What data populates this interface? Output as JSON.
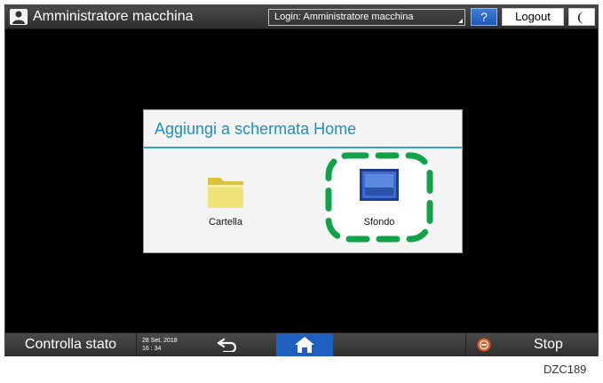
{
  "topbar": {
    "title": "Amministratore macchina",
    "login": "Login: Amministratore macchina",
    "help_label": "?",
    "logout_label": "Logout"
  },
  "dialog": {
    "title": "Aggiungi a schermata Home",
    "items": [
      {
        "label": "Cartella",
        "icon": "folder-icon"
      },
      {
        "label": "Sfondo",
        "icon": "wallpaper-icon"
      }
    ]
  },
  "bottombar": {
    "status_label": "Controlla stato",
    "date": "28 Set. 2018",
    "time": "16 : 34",
    "stop_label": "Stop"
  },
  "figure_code": "DZC189",
  "colors": {
    "accent": "#1d8fc6",
    "highlight": "#12a34a",
    "home": "#1f5fc0",
    "stop": "#e05a2a"
  }
}
